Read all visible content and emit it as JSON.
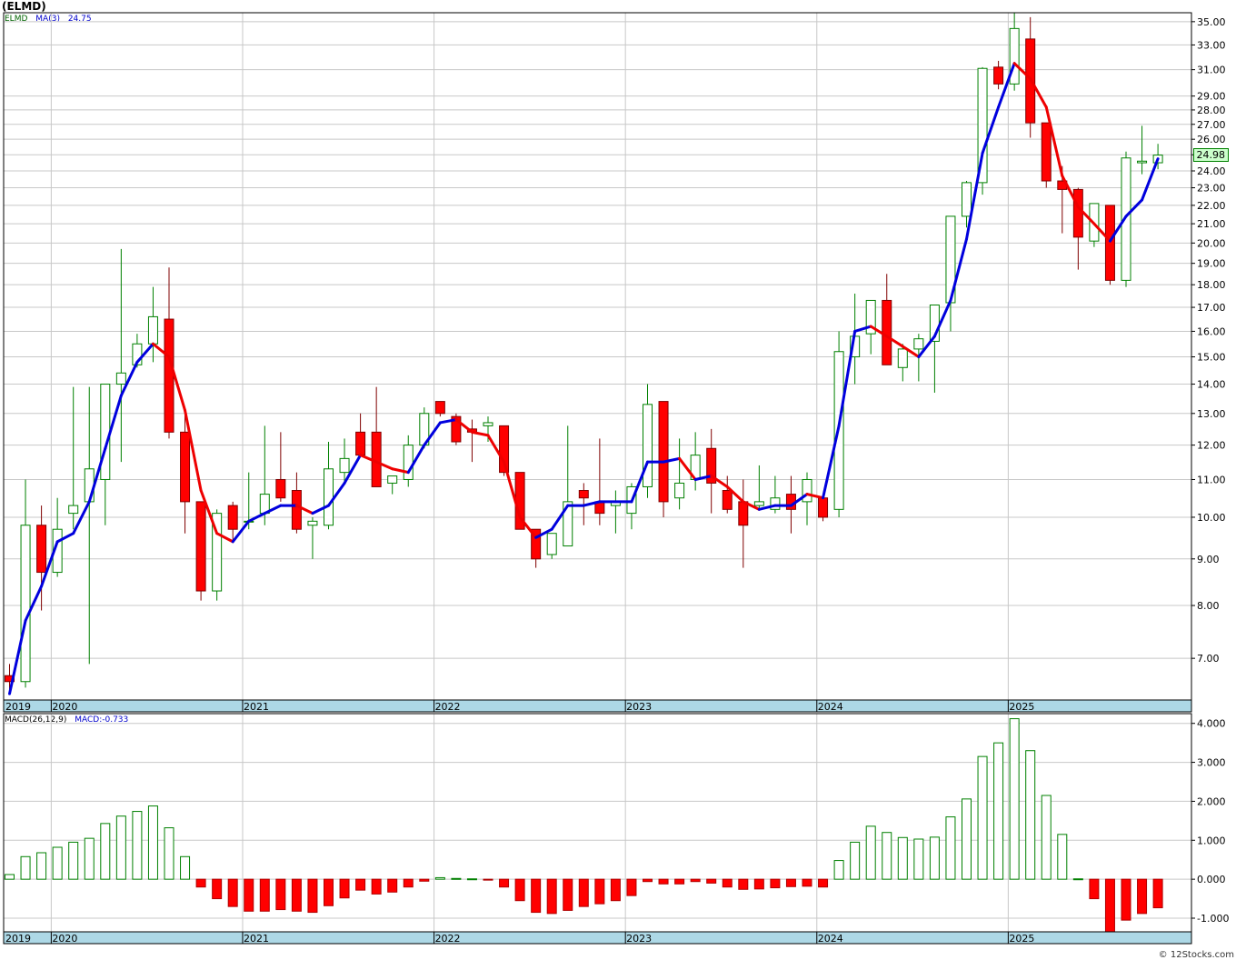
{
  "title": "(ELMD)",
  "legend": {
    "symbol": "ELMD",
    "ma_label": "MA(3)",
    "ma_value": "24.75"
  },
  "macd_legend": {
    "label": "MACD(26,12,9)",
    "value": "MACD:-0.733"
  },
  "last_price": "24.98",
  "watermark": "© 12Stocks.com",
  "colors": {
    "up": "#008000",
    "down": "#ff0000",
    "ma_up": "#0000dd",
    "ma_down": "#ee0000",
    "axis_band": "#add8e6",
    "grid": "#c8c8c8"
  },
  "chart_data": [
    {
      "type": "candlestick",
      "name": "ELMD",
      "scale": "log",
      "ylim": [
        6.3,
        35.8
      ],
      "y_ticks": [
        "7.00",
        "8.00",
        "9.00",
        "10.00",
        "11.00",
        "12.00",
        "13.00",
        "14.00",
        "15.00",
        "16.00",
        "17.00",
        "18.00",
        "19.00",
        "20.00",
        "21.00",
        "22.00",
        "23.00",
        "24.00",
        "25.00",
        "26.00",
        "27.00",
        "28.00",
        "29.00",
        "31.00",
        "33.00",
        "35.00"
      ],
      "x_labels": [
        "2019",
        "2020",
        "2021",
        "2022",
        "2023",
        "2024",
        "2025"
      ],
      "x_label_months": [
        0,
        3,
        15,
        27,
        39,
        51,
        63
      ],
      "candles": [
        [
          6.7,
          6.9,
          6.4,
          6.6
        ],
        [
          6.6,
          11.0,
          6.5,
          9.8
        ],
        [
          9.8,
          10.3,
          7.9,
          8.7
        ],
        [
          8.7,
          10.5,
          8.6,
          9.7
        ],
        [
          10.1,
          13.9,
          9.7,
          10.3
        ],
        [
          10.4,
          13.9,
          6.9,
          11.3
        ],
        [
          11.0,
          14.0,
          9.8,
          14.0
        ],
        [
          14.0,
          19.7,
          11.5,
          14.4
        ],
        [
          14.7,
          15.9,
          14.6,
          15.5
        ],
        [
          15.5,
          17.9,
          14.8,
          16.6
        ],
        [
          16.5,
          18.8,
          12.2,
          12.4
        ],
        [
          12.4,
          13.0,
          9.6,
          10.4
        ],
        [
          10.4,
          10.4,
          8.1,
          8.3
        ],
        [
          8.3,
          10.2,
          8.1,
          10.1
        ],
        [
          10.3,
          10.4,
          9.4,
          9.7
        ],
        [
          9.9,
          11.2,
          9.7,
          9.9
        ],
        [
          10.1,
          12.6,
          9.8,
          10.6
        ],
        [
          11.0,
          12.4,
          10.4,
          10.5
        ],
        [
          10.7,
          11.2,
          9.6,
          9.7
        ],
        [
          9.8,
          10.0,
          9.0,
          9.9
        ],
        [
          9.8,
          12.1,
          9.7,
          11.3
        ],
        [
          11.2,
          12.2,
          10.9,
          11.6
        ],
        [
          12.4,
          13.0,
          11.7,
          11.7
        ],
        [
          12.4,
          13.9,
          10.9,
          10.8
        ],
        [
          10.9,
          11.0,
          10.6,
          11.1
        ],
        [
          11.0,
          12.3,
          10.8,
          12.0
        ],
        [
          12.0,
          13.2,
          11.9,
          13.0
        ],
        [
          13.4,
          13.4,
          12.9,
          13.0
        ],
        [
          12.9,
          13.0,
          12.0,
          12.1
        ],
        [
          12.5,
          12.8,
          11.5,
          12.4
        ],
        [
          12.6,
          12.9,
          12.1,
          12.7
        ],
        [
          12.6,
          12.6,
          11.1,
          11.2
        ],
        [
          11.2,
          11.2,
          9.7,
          9.7
        ],
        [
          9.7,
          9.7,
          8.8,
          9.0
        ],
        [
          9.1,
          9.6,
          9.0,
          9.6
        ],
        [
          9.3,
          12.6,
          9.3,
          10.4
        ],
        [
          10.7,
          10.9,
          9.8,
          10.5
        ],
        [
          10.4,
          12.2,
          9.8,
          10.1
        ],
        [
          10.3,
          10.7,
          9.6,
          10.4
        ],
        [
          10.1,
          10.9,
          9.7,
          10.8
        ],
        [
          10.8,
          14.0,
          10.5,
          13.3
        ],
        [
          13.4,
          13.4,
          10.0,
          10.4
        ],
        [
          10.5,
          12.2,
          10.2,
          10.9
        ],
        [
          11.0,
          12.4,
          10.7,
          11.7
        ],
        [
          11.9,
          12.5,
          10.1,
          10.9
        ],
        [
          10.7,
          11.1,
          10.1,
          10.2
        ],
        [
          10.4,
          11.0,
          8.8,
          9.8
        ],
        [
          10.3,
          11.4,
          10.2,
          10.4
        ],
        [
          10.2,
          11.1,
          10.1,
          10.5
        ],
        [
          10.6,
          11.1,
          9.6,
          10.2
        ],
        [
          10.4,
          11.2,
          9.8,
          11.0
        ],
        [
          10.5,
          10.6,
          9.9,
          10.0
        ],
        [
          10.2,
          16.0,
          10.0,
          15.2
        ],
        [
          15.0,
          17.6,
          14.0,
          15.8
        ],
        [
          15.9,
          17.3,
          15.1,
          17.3
        ],
        [
          17.3,
          18.5,
          14.8,
          14.7
        ],
        [
          14.6,
          15.5,
          14.1,
          15.3
        ],
        [
          15.3,
          15.9,
          14.1,
          15.7
        ],
        [
          15.6,
          17.1,
          13.7,
          17.1
        ],
        [
          17.2,
          21.4,
          16.0,
          21.4
        ],
        [
          21.4,
          23.4,
          20.8,
          23.3
        ],
        [
          23.3,
          31.2,
          22.6,
          31.1
        ],
        [
          31.2,
          31.7,
          29.5,
          29.9
        ],
        [
          29.9,
          35.8,
          29.4,
          34.4
        ],
        [
          33.5,
          35.4,
          26.1,
          27.1
        ],
        [
          27.1,
          27.1,
          23.0,
          23.4
        ],
        [
          23.4,
          24.3,
          20.5,
          22.9
        ],
        [
          22.9,
          23.0,
          18.7,
          20.3
        ],
        [
          20.1,
          22.1,
          19.8,
          22.1
        ],
        [
          22.0,
          22.0,
          18.0,
          18.2
        ],
        [
          18.2,
          25.2,
          17.9,
          24.8
        ],
        [
          24.5,
          26.9,
          23.8,
          24.6
        ],
        [
          24.5,
          25.7,
          24.1,
          24.98
        ]
      ],
      "ma3": [
        6.4,
        7.7,
        8.4,
        9.4,
        9.6,
        10.4,
        11.9,
        13.6,
        14.8,
        15.5,
        15.0,
        13.1,
        10.7,
        9.6,
        9.4,
        9.9,
        10.1,
        10.3,
        10.3,
        10.1,
        10.3,
        10.9,
        11.7,
        11.5,
        11.3,
        11.2,
        12.0,
        12.7,
        12.8,
        12.4,
        12.3,
        11.5,
        10.0,
        9.5,
        9.7,
        10.3,
        10.3,
        10.4,
        10.4,
        10.4,
        11.5,
        11.5,
        11.6,
        11.0,
        11.1,
        10.8,
        10.4,
        10.2,
        10.3,
        10.3,
        10.6,
        10.5,
        12.6,
        16.0,
        16.2,
        15.8,
        15.4,
        15.0,
        15.8,
        17.3,
        20.2,
        25.1,
        28.2,
        31.5,
        30.3,
        28.2,
        23.7,
        21.9,
        21.0,
        20.1,
        21.4,
        22.3,
        24.75
      ]
    },
    {
      "type": "bar",
      "name": "MACD(26,12,9)",
      "ylim": [
        -1.35,
        4.25
      ],
      "y_ticks": [
        "-1.000",
        "0.000",
        "1.000",
        "2.000",
        "3.000",
        "4.000"
      ],
      "values": [
        0.12,
        0.58,
        0.68,
        0.82,
        0.95,
        1.05,
        1.43,
        1.62,
        1.74,
        1.88,
        1.32,
        0.58,
        -0.2,
        -0.5,
        -0.7,
        -0.82,
        -0.82,
        -0.78,
        -0.82,
        -0.85,
        -0.68,
        -0.48,
        -0.28,
        -0.38,
        -0.33,
        -0.2,
        -0.05,
        0.04,
        0.02,
        0.01,
        -0.02,
        -0.2,
        -0.55,
        -0.85,
        -0.88,
        -0.8,
        -0.7,
        -0.63,
        -0.55,
        -0.42,
        -0.06,
        -0.12,
        -0.12,
        -0.06,
        -0.1,
        -0.2,
        -0.26,
        -0.25,
        -0.22,
        -0.19,
        -0.18,
        -0.2,
        0.48,
        0.95,
        1.36,
        1.2,
        1.07,
        1.03,
        1.08,
        1.6,
        2.06,
        3.15,
        3.5,
        4.12,
        3.3,
        2.15,
        1.15,
        0.01,
        -0.5,
        -1.35,
        -1.05,
        -0.88,
        -0.733
      ]
    }
  ]
}
